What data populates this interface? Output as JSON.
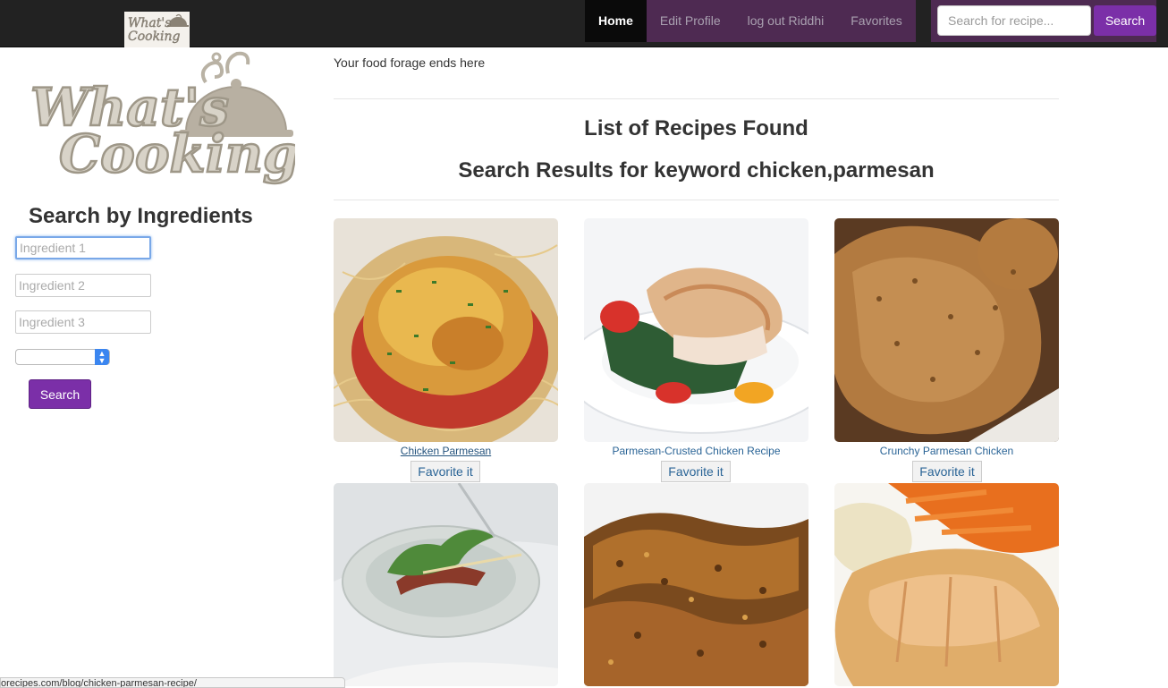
{
  "navbar": {
    "logo_text": "What's Cooking",
    "menu": [
      {
        "label": "Home",
        "active": true
      },
      {
        "label": "Edit Profile",
        "active": false
      },
      {
        "label": "log out Riddhi",
        "active": false
      },
      {
        "label": "Favorites",
        "active": false
      }
    ],
    "search_placeholder": "Search for recipe...",
    "search_button": "Search"
  },
  "sidebar": {
    "logo_text": "What's Cooking",
    "heading": "Search by Ingredients",
    "ingredient_placeholders": [
      "Ingredient 1",
      "Ingredient 2",
      "Ingredient 3"
    ],
    "select_value": "",
    "search_button": "Search"
  },
  "main": {
    "tagline": "Your food forage ends here",
    "list_heading": "List of Recipes Found",
    "results_prefix": "Search Results for keyword ",
    "results_keyword": "chicken,parmesan",
    "favorite_label": "Favorite it",
    "recipes": [
      {
        "title": "Chicken Parmesan",
        "hovered": true
      },
      {
        "title": "Parmesan-Crusted Chicken Recipe",
        "hovered": false
      },
      {
        "title": "Crunchy Parmesan Chicken",
        "hovered": false
      },
      {
        "title": "",
        "hovered": false
      },
      {
        "title": "",
        "hovered": false
      },
      {
        "title": "",
        "hovered": false
      }
    ]
  },
  "status_bar": {
    "url": "orecipes.com/blog/chicken-parmesan-recipe/"
  },
  "colors": {
    "navbar_bg": "#222222",
    "nav_menu_bg": "#4e2a52",
    "accent_purple": "#7b2fa8",
    "link_blue": "#2a6496"
  }
}
